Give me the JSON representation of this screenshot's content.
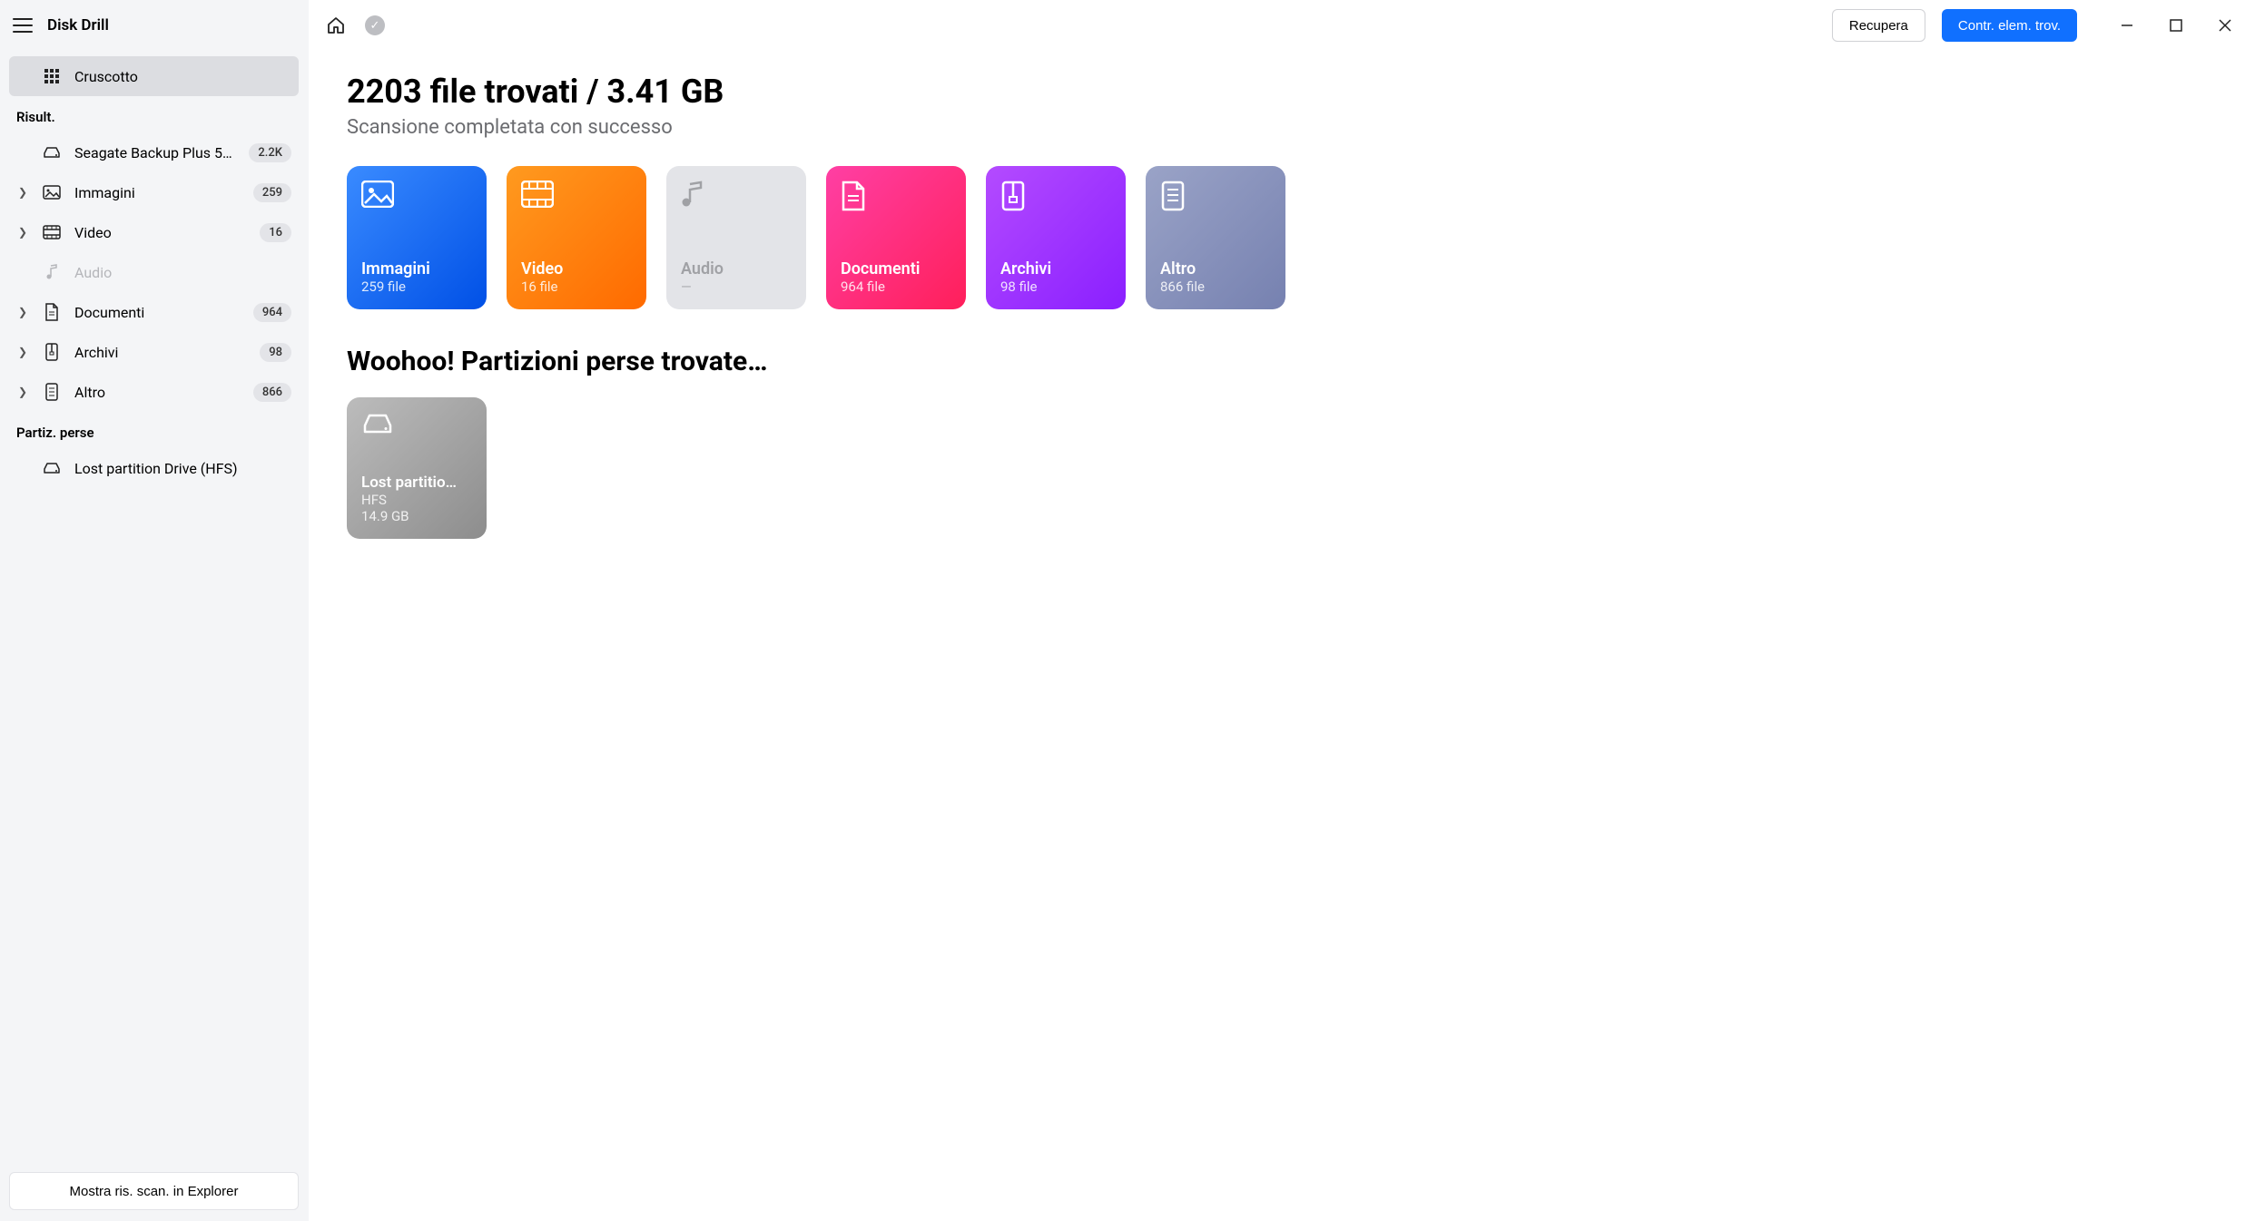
{
  "app_name": "Disk Drill",
  "sidebar": {
    "dashboard_label": "Cruscotto",
    "results_header": "Risult.",
    "drive": {
      "label": "Seagate Backup Plus 50…",
      "badge": "2.2K"
    },
    "items": [
      {
        "label": "Immagini",
        "badge": "259"
      },
      {
        "label": "Video",
        "badge": "16"
      },
      {
        "label": "Audio",
        "badge": ""
      },
      {
        "label": "Documenti",
        "badge": "964"
      },
      {
        "label": "Archivi",
        "badge": "98"
      },
      {
        "label": "Altro",
        "badge": "866"
      }
    ],
    "lost_header": "Partiz. perse",
    "lost_item": "Lost partition Drive (HFS)",
    "footer_btn": "Mostra ris. scan. in Explorer"
  },
  "topbar": {
    "recover_btn": "Recupera",
    "review_btn": "Contr. elem. trov."
  },
  "main": {
    "title": "2203 file trovati / 3.41 GB",
    "subtitle": "Scansione completata con successo",
    "cards": [
      {
        "title": "Immagini",
        "sub": "259 file"
      },
      {
        "title": "Video",
        "sub": "16 file"
      },
      {
        "title": "Audio",
        "sub": "—"
      },
      {
        "title": "Documenti",
        "sub": "964 file"
      },
      {
        "title": "Archivi",
        "sub": "98 file"
      },
      {
        "title": "Altro",
        "sub": "866 file"
      }
    ],
    "lost_title": "Woohoo! Partizioni perse trovate…",
    "partition": {
      "title": "Lost partitio…",
      "fs": "HFS",
      "size": "14.9 GB"
    }
  }
}
